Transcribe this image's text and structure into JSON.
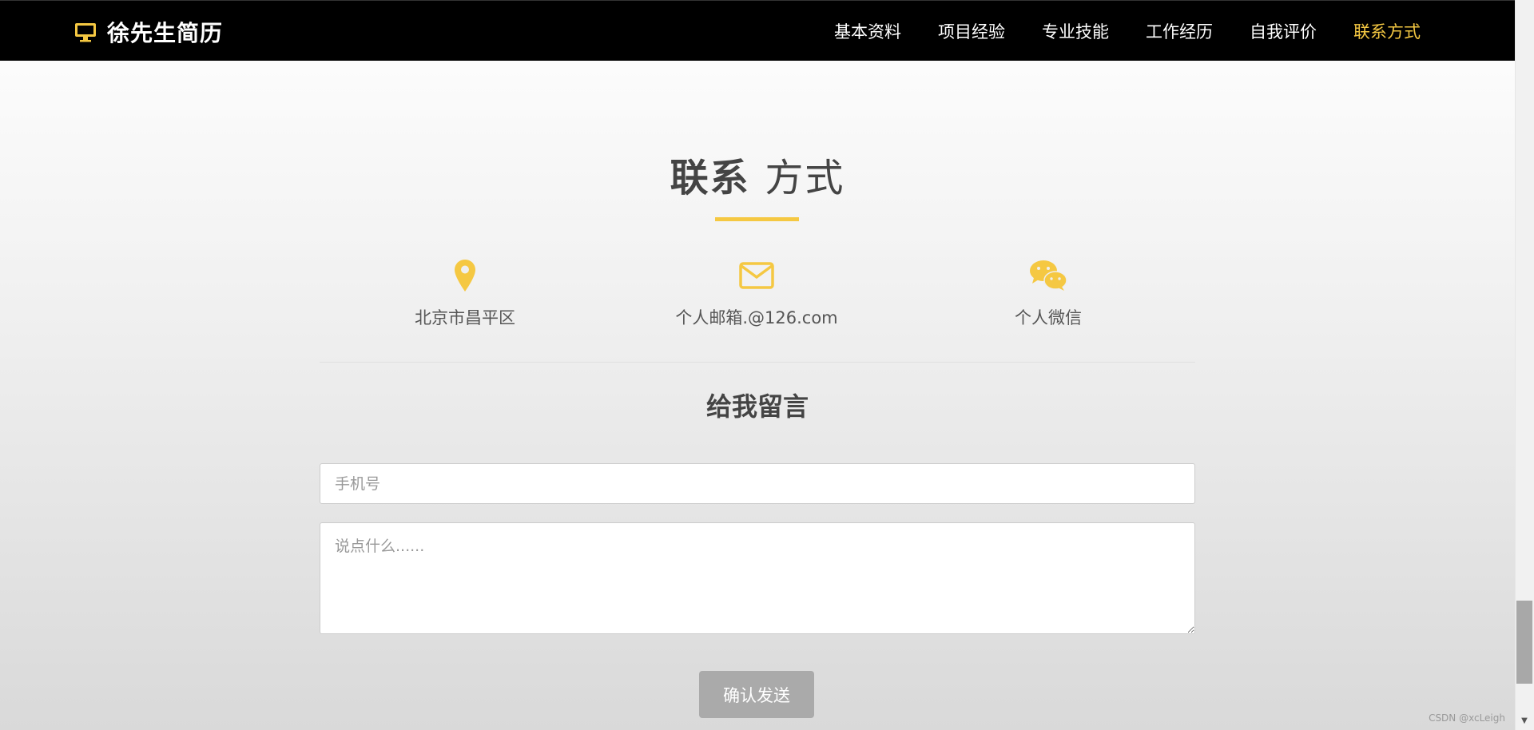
{
  "brand": {
    "title": "徐先生简历",
    "icon": "monitor-icon"
  },
  "nav": {
    "items": [
      {
        "label": "基本资料"
      },
      {
        "label": "项目经验"
      },
      {
        "label": "专业技能"
      },
      {
        "label": "工作经历"
      },
      {
        "label": "自我评价"
      },
      {
        "label": "联系方式",
        "active": true
      }
    ]
  },
  "section": {
    "title_bold": "联系",
    "title_light": "方式"
  },
  "contacts": [
    {
      "icon": "location-pin-icon",
      "text": "北京市昌平区"
    },
    {
      "icon": "envelope-icon",
      "text": "个人邮箱.@126.com"
    },
    {
      "icon": "wechat-icon",
      "text": "个人微信"
    }
  ],
  "message": {
    "title": "给我留言",
    "phone_placeholder": "手机号",
    "text_placeholder": "说点什么......",
    "send_label": "确认发送"
  },
  "watermark": "CSDN @xcLeigh",
  "colors": {
    "accent": "#f5c842",
    "navbar_bg": "#000000",
    "button_bg": "#aaaaaa"
  }
}
